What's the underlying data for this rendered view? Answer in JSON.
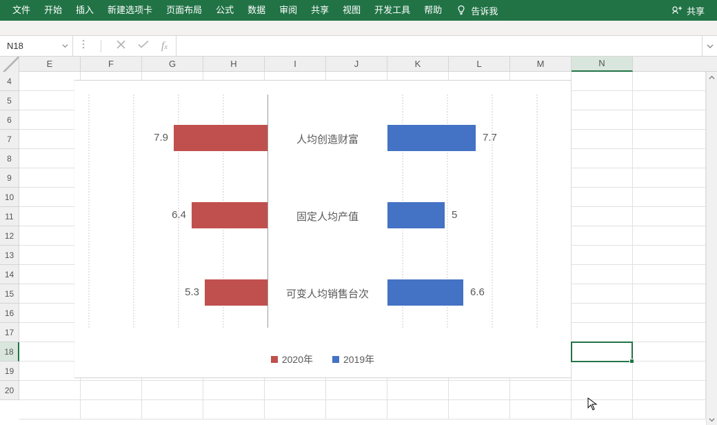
{
  "ribbon": {
    "tabs": [
      "文件",
      "开始",
      "插入",
      "新建选项卡",
      "页面布局",
      "公式",
      "数据",
      "审阅",
      "共享",
      "视图",
      "开发工具",
      "帮助"
    ],
    "tell_me": "告诉我",
    "share": "共享"
  },
  "name_box": {
    "value": "N18"
  },
  "columns": [
    "E",
    "F",
    "G",
    "H",
    "I",
    "J",
    "K",
    "L",
    "M",
    "N"
  ],
  "active_column": "N",
  "rows": [
    "4",
    "5",
    "6",
    "7",
    "8",
    "9",
    "10",
    "11",
    "12",
    "13",
    "14",
    "15",
    "16",
    "17",
    "18",
    "19",
    "20"
  ],
  "active_row": "18",
  "legend": {
    "left": "2020年",
    "right": "2019年"
  },
  "chart_data": {
    "type": "bar",
    "orientation": "horizontal-diverging",
    "categories": [
      "人均创造财富",
      "固定人均产值",
      "可变人均销售台次"
    ],
    "series": [
      {
        "name": "2020年",
        "values": [
          7.9,
          6.4,
          5.3
        ],
        "color": "#c0504d",
        "side": "left"
      },
      {
        "name": "2019年",
        "values": [
          7.7,
          5.0,
          6.6
        ],
        "color": "#4472c4",
        "side": "right"
      }
    ],
    "title": "",
    "xlim": [
      0,
      10
    ]
  }
}
